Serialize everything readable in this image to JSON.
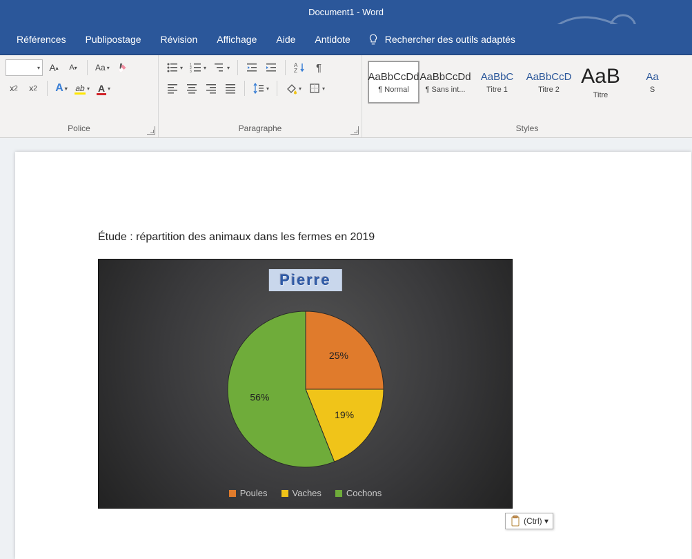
{
  "title": "Document1  -  Word",
  "tabs": {
    "references": "Références",
    "mailings": "Publipostage",
    "review": "Révision",
    "view": "Affichage",
    "help": "Aide",
    "antidote": "Antidote",
    "tell_me": "Rechercher des outils adaptés"
  },
  "ribbon": {
    "font_group": "Police",
    "paragraph_group": "Paragraphe",
    "styles_group": "Styles"
  },
  "styles": [
    {
      "preview": "AaBbCcDd",
      "name": "¶ Normal",
      "cls": ""
    },
    {
      "preview": "AaBbCcDd",
      "name": "¶ Sans int...",
      "cls": ""
    },
    {
      "preview": "AaBbC",
      "name": "Titre 1",
      "cls": "blue"
    },
    {
      "preview": "AaBbCcD",
      "name": "Titre 2",
      "cls": "blue"
    },
    {
      "preview": "AaB",
      "name": "Titre",
      "cls": "big"
    },
    {
      "preview": "Aa",
      "name": "S",
      "cls": "blue"
    }
  ],
  "document": {
    "heading": "Étude : répartition des animaux dans les fermes en 2019"
  },
  "chart_data": {
    "type": "pie",
    "title": "Pierre",
    "categories": [
      "Poules",
      "Vaches",
      "Cochons"
    ],
    "values": [
      25,
      19,
      56
    ],
    "labels": [
      "25%",
      "19%",
      "56%"
    ],
    "colors": [
      "#e07b2c",
      "#f0c419",
      "#6fac3a"
    ]
  },
  "paste_options": "(Ctrl) ▾"
}
